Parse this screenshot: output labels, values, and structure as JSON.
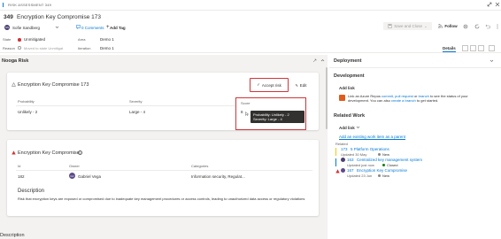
{
  "colors": {
    "accent": "#0078d4",
    "danger": "#d13438",
    "pane": "#f3f2f1",
    "status_green": "#107c10",
    "status_gray": "#8a8886",
    "azure_repos": "#e05b1c"
  },
  "topbar": {
    "type_label": "RISK ASSESSMENT 349",
    "icons": [
      "expand-icon",
      "close-icon"
    ]
  },
  "header": {
    "id": "349",
    "title": "Encryption Key Compromise 173",
    "assignee": "Sofie Sandberg",
    "comments": "0 Comments",
    "add_tag": "Add Tag",
    "save_label": "Save and Close",
    "follow_label": "Follow",
    "updated_by": "Updated by Sofie Sandberg"
  },
  "meta": {
    "state_label": "State",
    "state_value": "Unmitigated",
    "reason_label": "Reason",
    "reason_value": "Moved to state Unmitigat",
    "area_label": "Area",
    "area_value": "Demo 1",
    "iteration_label": "Iteration",
    "iteration_value": "Demo 1",
    "tabs": [
      "Details"
    ]
  },
  "left": {
    "section_title": "Nooga Risk",
    "card1": {
      "title": "Encryption Key Compromise 173",
      "accept_label": "Accept risk",
      "edit_label": "Edit",
      "col_probability": "Probability",
      "col_severity": "Severity",
      "col_score": "Score",
      "probability_value": "Unlikely - 2",
      "severity_value": "Large - 4",
      "score_value": "8",
      "tooltip_line1": "Probability: Unlikely - 2",
      "tooltip_line2": "Severity: Large - 4"
    },
    "card2": {
      "title": "Encryption Key Compromise",
      "col_id": "Id",
      "col_owner": "Owner",
      "col_categories": "Categories",
      "id_value": "182",
      "owner_value": "Gabriel Vega",
      "owner_initials": "GV",
      "categories_value": "Information security, Regulat...",
      "description_heading": "Description",
      "description_text": "Risk that encryption keys are exposed or compromised due to inadequate key management procedures or access controls, leading to unauthorized data access or regulatory violations"
    },
    "bottom_heading": "Description"
  },
  "right": {
    "deployment_title": "Deployment",
    "development_title": "Development",
    "add_link": "Add link",
    "dev_text_1": "Link an Azure Repos ",
    "dev_commit": "commit",
    "dev_pull": "pull request",
    "dev_or": " or ",
    "dev_branch": "branch",
    "dev_text_2": " to see the status of your development. You can also ",
    "dev_create": "create a branch",
    "dev_text_3": " to get started.",
    "related_title": "Related Work",
    "add_link_2": "Add link",
    "existing_link": "Add an existing work item as a parent",
    "related_label": "Related",
    "items": [
      {
        "id": "173",
        "title": "5 Platform Operations",
        "updated": "Updated 30 May",
        "status": "New",
        "status_color": "#8a8886"
      },
      {
        "id": "163",
        "title": "Centralized key management system",
        "updated": "Updated just now",
        "status": "Closed",
        "status_color": "#107c10"
      },
      {
        "id": "167",
        "title": "Encryption Key Compromise",
        "updated": "Updated 23 Jun",
        "status": "New",
        "status_color": "#8a8886"
      }
    ]
  }
}
